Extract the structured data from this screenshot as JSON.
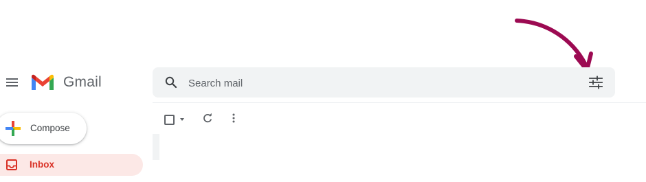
{
  "app": {
    "name": "Gmail"
  },
  "header": {
    "menu_icon": "hamburger-menu-icon",
    "logo_icon": "gmail-logo-icon",
    "brand_label": "Gmail"
  },
  "search": {
    "placeholder": "Search mail",
    "value": "",
    "search_icon": "magnifier-icon",
    "options_icon": "tune-sliders-icon"
  },
  "compose": {
    "label": "Compose",
    "icon": "multicolor-plus-icon"
  },
  "nav": {
    "items": [
      {
        "label": "Inbox",
        "icon": "inbox-icon",
        "active": true
      }
    ]
  },
  "toolbar": {
    "select_icon": "checkbox-icon",
    "refresh_icon": "refresh-icon",
    "more_icon": "more-vertical-icon"
  },
  "annotation": {
    "arrow_icon": "curved-arrow-icon",
    "color": "#9c0a52"
  },
  "colors": {
    "search_bg": "#f1f3f4",
    "inbox_highlight": "#fce8e6",
    "inbox_text": "#d93025",
    "icon_gray": "#5f6368"
  }
}
